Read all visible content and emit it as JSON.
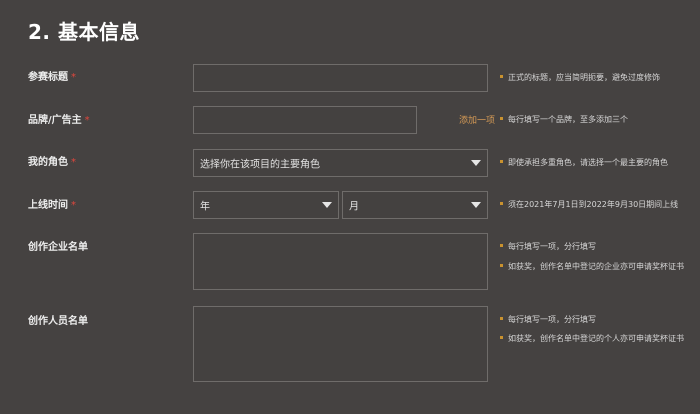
{
  "section": {
    "title": "2. 基本信息"
  },
  "required_mark": "*",
  "form": {
    "entry_title": {
      "label": "参赛标题",
      "value": "",
      "hint": "正式的标题，应当简明扼要，避免过度修饰"
    },
    "brand": {
      "label": "品牌/广告主",
      "value": "",
      "add_label": "添加一项",
      "hint": "每行填写一个品牌，至多添加三个"
    },
    "role": {
      "label": "我的角色",
      "selected": "选择你在该项目的主要角色",
      "hint": "即使承担多重角色，请选择一个最主要的角色"
    },
    "launch_time": {
      "label": "上线时间",
      "year": "年",
      "month": "月",
      "hint": "须在2021年7月1日到2022年9月30日期间上线"
    },
    "companies": {
      "label": "创作企业名单",
      "value": "",
      "hints": [
        "每行填写一项，分行填写",
        "如获奖，创作名单中登记的企业亦可申请奖杯证书"
      ]
    },
    "people": {
      "label": "创作人员名单",
      "value": "",
      "hints": [
        "每行填写一项，分行填写",
        "如获奖，创作名单中登记的个人亦可申请奖杯证书"
      ]
    }
  },
  "colors": {
    "background": "#454241",
    "required": "#e0473d",
    "accent": "#d59a55",
    "hint_dot": "#c9922f"
  }
}
